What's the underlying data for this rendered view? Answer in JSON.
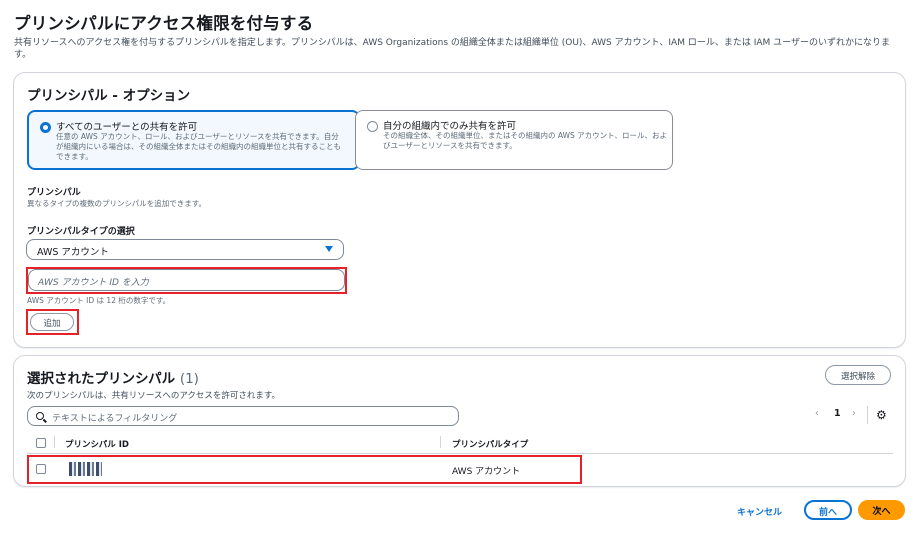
{
  "page": {
    "title": "プリンシパルにアクセス権限を付与する",
    "description": "共有リソースへのアクセス権を付与するプリンシパルを指定します。プリンシパルは、AWS Organizations の組織全体または組織単位 (OU)、AWS アカウント、IAM ロール、または IAM ユーザーのいずれかになります。"
  },
  "options_panel": {
    "heading": "プリンシパル - オプション",
    "tiles": [
      {
        "title": "すべてのユーザーとの共有を許可",
        "description": "任意の AWS アカウント、ロール、およびユーザーとリソースを共有できます。自分が組織内にいる場合は、その組織全体またはその組織内の組織単位と共有することもできます。",
        "selected": true
      },
      {
        "title": "自分の組織内でのみ共有を許可",
        "description": "その組織全体、その組織単位、またはその組織内の AWS アカウント、ロール、およびユーザーとリソースを共有できます。",
        "selected": false
      }
    ],
    "principal_label": "プリンシパル",
    "principal_desc": "異なるタイプの複数のプリンシパルを追加できます。",
    "type_label": "プリンシパルタイプの選択",
    "type_value": "AWS アカウント",
    "input_placeholder": "AWS アカウント ID を入力",
    "input_hint": "AWS アカウント ID は 12 桁の数字です。",
    "add_label": "追加"
  },
  "selected_panel": {
    "heading": "選択されたプリンシパル",
    "count": "(1)",
    "clear_label": "選択解除",
    "description": "次のプリンシパルは、共有リソースへのアクセスを許可されます。",
    "filter_placeholder": "テキストによるフィルタリング",
    "pager": {
      "prev": "‹",
      "page": "1",
      "next": "›"
    },
    "columns": [
      "プリンシパル ID",
      "プリンシパルタイプ"
    ],
    "rows": [
      {
        "type": "AWS アカウント"
      }
    ]
  },
  "footer": {
    "cancel_label": "キャンセル",
    "prev_label": "前へ",
    "next_label": "次へ"
  },
  "colors": {
    "accent": "#0972d3",
    "primary_button": "#ff9900",
    "highlight": "#e5212a"
  }
}
